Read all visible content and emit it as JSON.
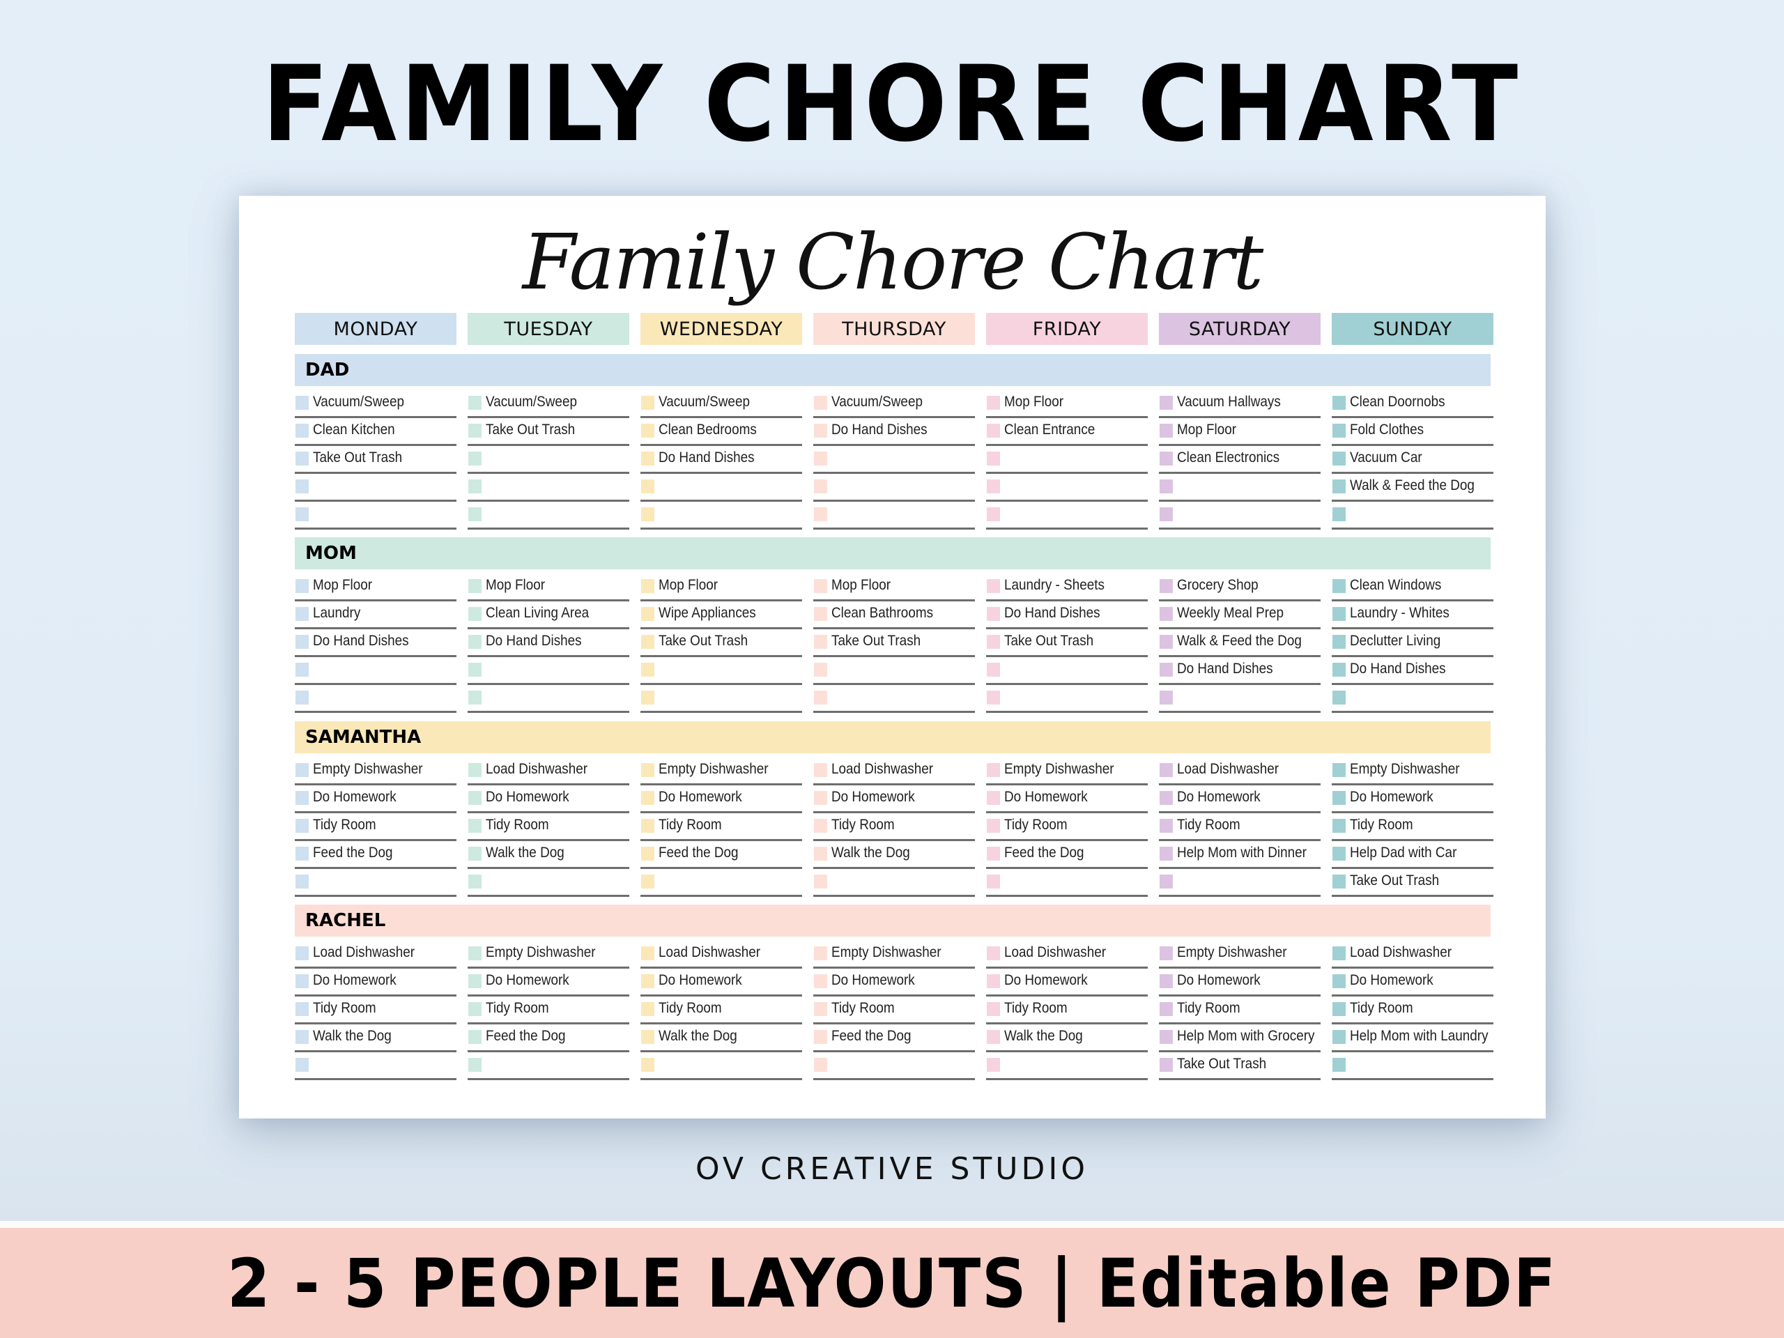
{
  "header": {
    "title": "FAMILY CHORE CHART"
  },
  "card": {
    "script_title": "Family Chore Chart",
    "days": [
      {
        "label": "MONDAY",
        "color": "#cfe0f0"
      },
      {
        "label": "TUESDAY",
        "color": "#cde9e0"
      },
      {
        "label": "WEDNESDAY",
        "color": "#fbe8b8"
      },
      {
        "label": "THURSDAY",
        "color": "#fce0d8"
      },
      {
        "label": "FRIDAY",
        "color": "#f7d3e0"
      },
      {
        "label": "SATURDAY",
        "color": "#dcc3e1"
      },
      {
        "label": "SUNDAY",
        "color": "#a0d0d3"
      }
    ],
    "people": [
      {
        "name": "DAD",
        "color": "#cfe0f0",
        "chores": [
          [
            "Vacuum/Sweep",
            "Clean Kitchen",
            "Take Out Trash",
            "",
            ""
          ],
          [
            "Vacuum/Sweep",
            "Take Out Trash",
            "",
            "",
            ""
          ],
          [
            "Vacuum/Sweep",
            "Clean Bedrooms",
            "Do Hand Dishes",
            "",
            ""
          ],
          [
            "Vacuum/Sweep",
            "Do Hand Dishes",
            "",
            "",
            ""
          ],
          [
            "Mop Floor",
            "Clean Entrance",
            "",
            "",
            ""
          ],
          [
            "Vacuum Hallways",
            "Mop Floor",
            "Clean Electronics",
            "",
            ""
          ],
          [
            "Clean Doornobs",
            "Fold Clothes",
            "Vacuum Car",
            "Walk & Feed the Dog",
            ""
          ]
        ]
      },
      {
        "name": "MOM",
        "color": "#cde9e0",
        "chores": [
          [
            "Mop Floor",
            "Laundry",
            "Do Hand Dishes",
            "",
            ""
          ],
          [
            "Mop Floor",
            "Clean Living Area",
            "Do Hand Dishes",
            "",
            ""
          ],
          [
            "Mop Floor",
            "Wipe Appliances",
            "Take Out Trash",
            "",
            ""
          ],
          [
            "Mop Floor",
            "Clean Bathrooms",
            "Take Out Trash",
            "",
            ""
          ],
          [
            "Laundry - Sheets",
            "Do Hand Dishes",
            "Take Out Trash",
            "",
            ""
          ],
          [
            "Grocery Shop",
            "Weekly Meal Prep",
            "Walk & Feed the Dog",
            "Do Hand Dishes",
            ""
          ],
          [
            "Clean Windows",
            "Laundry - Whites",
            "Declutter Living",
            "Do Hand Dishes",
            ""
          ]
        ]
      },
      {
        "name": "SAMANTHA",
        "color": "#fbe8b8",
        "chores": [
          [
            "Empty Dishwasher",
            "Do Homework",
            "Tidy Room",
            "Feed the Dog",
            ""
          ],
          [
            "Load Dishwasher",
            "Do Homework",
            "Tidy Room",
            "Walk the Dog",
            ""
          ],
          [
            "Empty Dishwasher",
            "Do Homework",
            "Tidy Room",
            "Feed the Dog",
            ""
          ],
          [
            "Load Dishwasher",
            "Do Homework",
            "Tidy Room",
            "Walk the Dog",
            ""
          ],
          [
            "Empty Dishwasher",
            "Do Homework",
            "Tidy Room",
            "Feed the Dog",
            ""
          ],
          [
            "Load Dishwasher",
            "Do Homework",
            "Tidy Room",
            "Help Mom with Dinner",
            ""
          ],
          [
            "Empty Dishwasher",
            "Do Homework",
            "Tidy Room",
            "Help Dad with Car",
            "Take Out Trash"
          ]
        ]
      },
      {
        "name": "RACHEL",
        "color": "#fcded6",
        "chores": [
          [
            "Load Dishwasher",
            "Do Homework",
            "Tidy Room",
            "Walk the Dog",
            ""
          ],
          [
            "Empty Dishwasher",
            "Do Homework",
            "Tidy Room",
            "Feed the Dog",
            ""
          ],
          [
            "Load Dishwasher",
            "Do Homework",
            "Tidy Room",
            "Walk the Dog",
            ""
          ],
          [
            "Empty Dishwasher",
            "Do Homework",
            "Tidy Room",
            "Feed the Dog",
            ""
          ],
          [
            "Load Dishwasher",
            "Do Homework",
            "Tidy Room",
            "Walk the Dog",
            ""
          ],
          [
            "Empty Dishwasher",
            "Do Homework",
            "Tidy Room",
            "Help Mom with Grocery",
            "Take Out Trash"
          ],
          [
            "Load Dishwasher",
            "Do Homework",
            "Tidy Room",
            "Help Mom with Laundry",
            ""
          ]
        ]
      }
    ]
  },
  "footer": {
    "studio": "OV CREATIVE STUDIO",
    "banner": "2 - 5 PEOPLE LAYOUTS | Editable PDF",
    "banner_color": "#f7cfc6"
  }
}
